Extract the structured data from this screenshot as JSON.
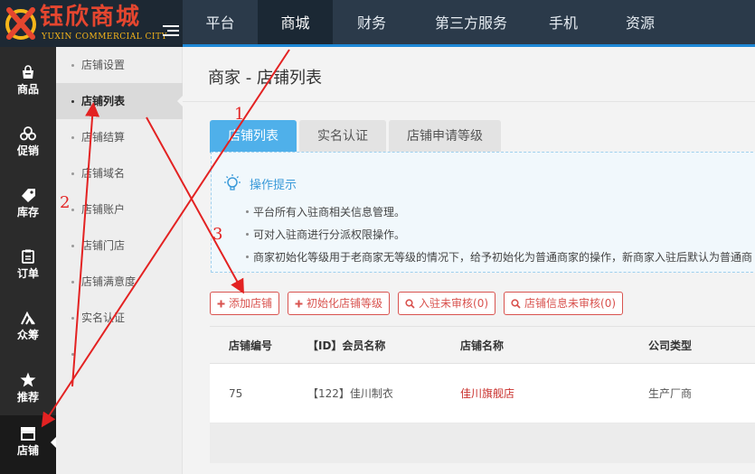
{
  "logo": {
    "name_cn": "钰欣商城",
    "name_en": "YUXIN COMMERCIAL CITY"
  },
  "top_nav": {
    "items": [
      "平台",
      "商城",
      "财务",
      "第三方服务",
      "手机",
      "资源"
    ],
    "active": "商城",
    "accent_color": "#1e88d6"
  },
  "icon_sidebar": {
    "items": [
      {
        "label": "商品",
        "icon": "shopping-bag-icon"
      },
      {
        "label": "促销",
        "icon": "promotion-icon"
      },
      {
        "label": "库存",
        "icon": "tag-icon"
      },
      {
        "label": "订单",
        "icon": "order-icon"
      },
      {
        "label": "众筹",
        "icon": "crowdfunding-icon"
      },
      {
        "label": "推荐",
        "icon": "star-icon"
      },
      {
        "label": "店铺",
        "icon": "store-icon"
      }
    ],
    "active": "店铺"
  },
  "sub_menu": {
    "items": [
      "店铺设置",
      "店铺列表",
      "店铺结算",
      "店铺域名",
      "店铺账户",
      "店铺门店",
      "店铺满意度",
      "实名认证",
      ""
    ],
    "active": "店铺列表"
  },
  "page": {
    "title": "商家 - 店铺列表"
  },
  "tabs": {
    "items": [
      "店铺列表",
      "实名认证",
      "店铺申请等级"
    ],
    "active": "店铺列表",
    "active_color": "#4fb0ea"
  },
  "tips": {
    "title": "操作提示",
    "lines": [
      "平台所有入驻商相关信息管理。",
      "可对入驻商进行分派权限操作。",
      "商家初始化等级用于老商家无等级的情况下，给予初始化为普通商家的操作，新商家入驻后默认为普通商"
    ]
  },
  "actions": {
    "add_store": "添加店铺",
    "init_level": "初始化店铺等级",
    "pending_entry": "入驻未审核(0)",
    "pending_info": "店铺信息未审核(0)",
    "button_color": "#d9534f"
  },
  "table": {
    "columns": [
      "店铺编号",
      "【ID】会员名称",
      "店铺名称",
      "公司类型"
    ],
    "rows": [
      {
        "id": "75",
        "member": "【122】佳川制衣",
        "store": "佳川旗舰店",
        "company_type": "生产厂商"
      }
    ]
  },
  "annotations": {
    "numbers": [
      "1",
      "2",
      "3"
    ],
    "color": "#e32222"
  }
}
